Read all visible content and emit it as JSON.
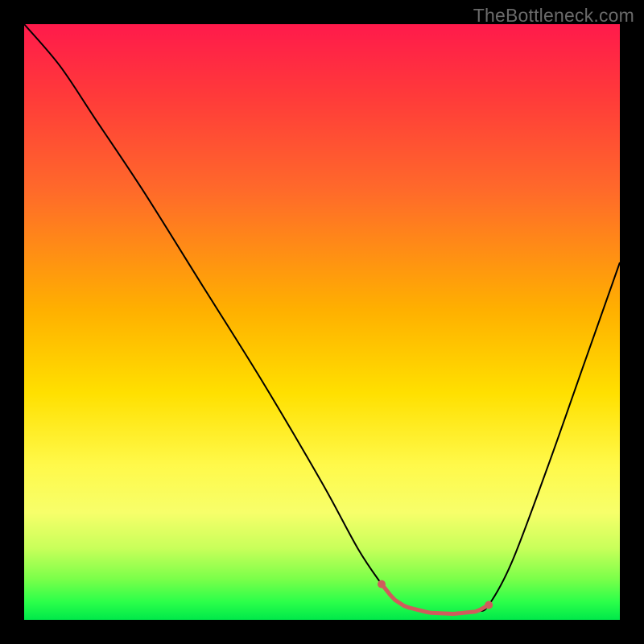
{
  "watermark": "TheBottleneck.com",
  "colors": {
    "background": "#000000",
    "gradient_top": "#ff1a4b",
    "gradient_bottom": "#00e84a",
    "curve": "#000000",
    "highlight": "#cf5c5c"
  },
  "chart_data": {
    "type": "line",
    "title": "",
    "xlabel": "",
    "ylabel": "",
    "xlim": [
      0,
      100
    ],
    "ylim": [
      0,
      100
    ],
    "grid": false,
    "series": [
      {
        "name": "bottleneck-curve",
        "x": [
          0,
          6,
          12,
          20,
          30,
          40,
          50,
          56,
          60,
          62,
          64,
          68,
          72,
          76,
          78,
          82,
          88,
          94,
          100
        ],
        "y": [
          100,
          93,
          84,
          72,
          56,
          40,
          23,
          12,
          6,
          3.5,
          2.2,
          1.2,
          1.0,
          1.4,
          2.5,
          10,
          26,
          43,
          60
        ]
      }
    ],
    "annotations": [
      {
        "name": "optimal-range",
        "x_start": 60,
        "x_end": 78,
        "y_approx": 1.5
      }
    ]
  }
}
